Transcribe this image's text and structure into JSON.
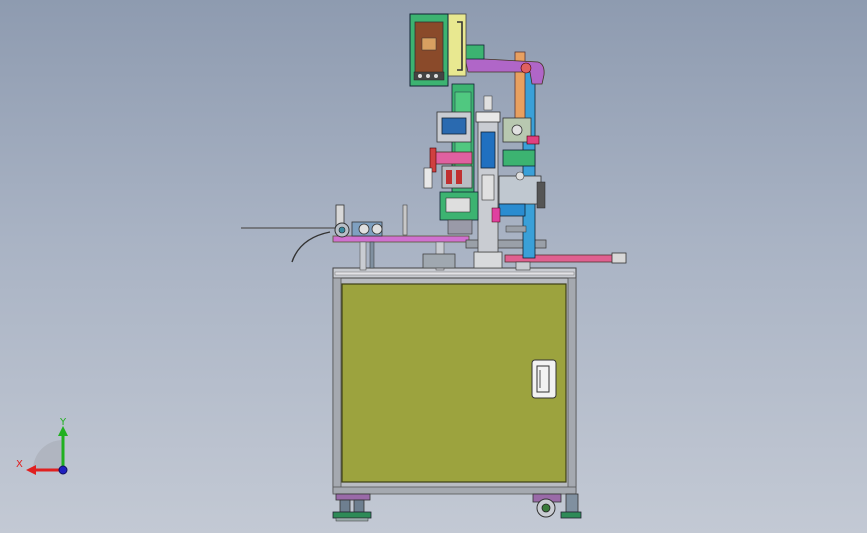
{
  "viewport": {
    "background_top": "#8e9bb0",
    "background_bottom": "#c3c9d4"
  },
  "model": {
    "cabinet_panel_color": "#9ca33e",
    "frame_color": "#b9bcc2",
    "arm_color": "#b066c8",
    "column_color": "#3aa0d8",
    "slide_color": "#3cb371",
    "bracket_color": "#e8e890",
    "rail_color": "#e06090"
  },
  "triad": {
    "x_label": "X",
    "y_label": "Y",
    "x_color": "#e02020",
    "y_color": "#20b020",
    "z_color": "#2020c0"
  }
}
